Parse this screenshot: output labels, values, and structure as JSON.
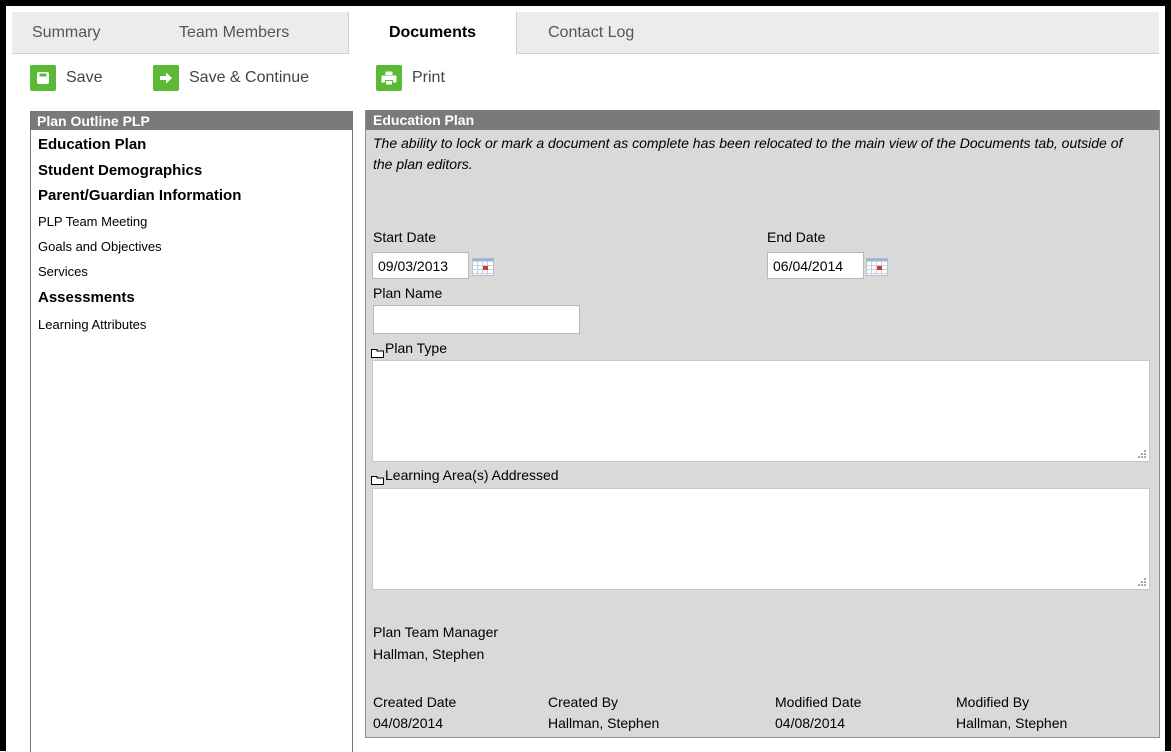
{
  "tabs": [
    {
      "label": "Summary",
      "active": false
    },
    {
      "label": "Team Members",
      "active": false
    },
    {
      "label": "Documents",
      "active": true
    },
    {
      "label": "Contact Log",
      "active": false
    }
  ],
  "toolbar": {
    "save_label": "Save",
    "save_continue_label": "Save & Continue",
    "print_label": "Print",
    "accent_color": "#5ab935"
  },
  "outline": {
    "title": "Plan Outline PLP",
    "items": [
      {
        "label": "Education Plan",
        "bold": true
      },
      {
        "label": "Student Demographics",
        "bold": true
      },
      {
        "label": "Parent/Guardian Information",
        "bold": true
      },
      {
        "label": "PLP Team Meeting",
        "bold": false
      },
      {
        "label": "Goals and Objectives",
        "bold": false
      },
      {
        "label": "Services",
        "bold": false
      },
      {
        "label": "Assessments",
        "bold": true
      },
      {
        "label": "Learning Attributes",
        "bold": false
      }
    ]
  },
  "editor": {
    "title": "Education Plan",
    "note": "The ability to lock or mark a document as complete has been relocated to the main view of the Documents tab, outside of the plan editors.",
    "start_date_label": "Start Date",
    "start_date_value": "09/03/2013",
    "end_date_label": "End Date",
    "end_date_value": "06/04/2014",
    "plan_name_label": "Plan Name",
    "plan_name_value": "",
    "plan_type_label": "Plan Type",
    "learning_area_label": "Learning Area(s) Addressed",
    "team_manager_label": "Plan Team Manager",
    "team_manager_value": "Hallman, Stephen",
    "created_date_label": "Created Date",
    "created_date_value": "04/08/2014",
    "created_by_label": "Created By",
    "created_by_value": "Hallman, Stephen",
    "modified_date_label": "Modified Date",
    "modified_date_value": "04/08/2014",
    "modified_by_label": "Modified By",
    "modified_by_value": "Hallman, Stephen"
  }
}
